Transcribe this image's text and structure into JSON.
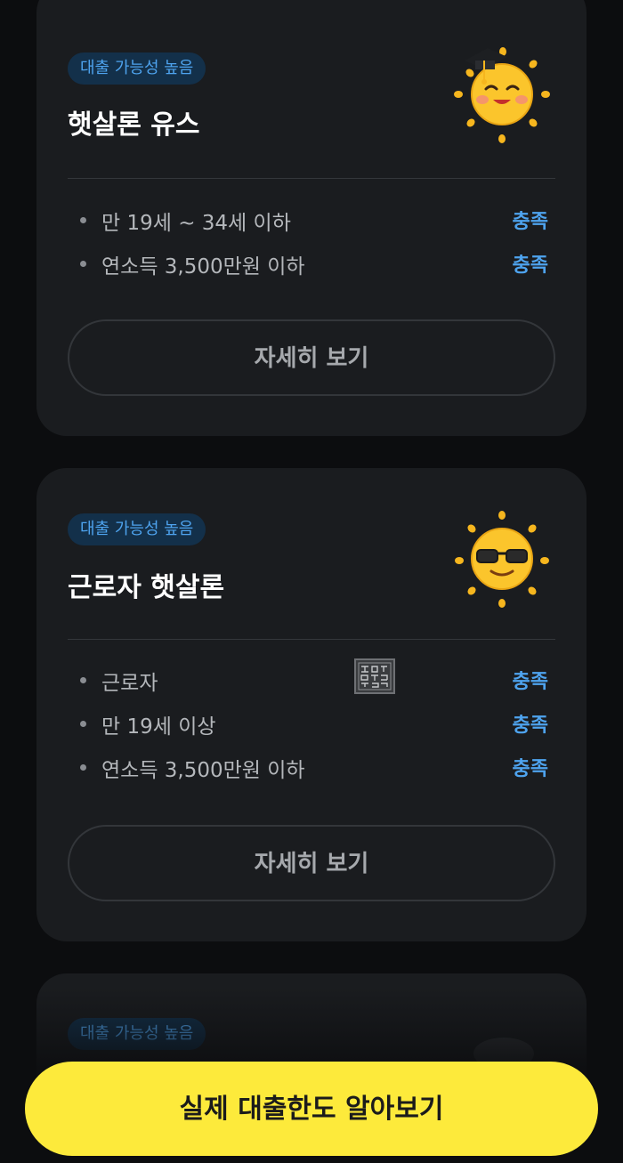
{
  "cards": [
    {
      "badge": "대출 가능성 높음",
      "title": "햇살론 유스",
      "mascot_icon": "graduation-sun-icon",
      "criteria": [
        {
          "label": "만 19세 ~ 34세 이하",
          "status": "충족"
        },
        {
          "label": "연소득 3,500만원 이하",
          "status": "충족"
        }
      ],
      "detail_button": "자세히 보기"
    },
    {
      "badge": "대출 가능성 높음",
      "title": "근로자 햇살론",
      "mascot_icon": "sunglasses-sun-icon",
      "criteria": [
        {
          "label": "근로자",
          "status": "충족"
        },
        {
          "label": "만 19세 이상",
          "status": "충족"
        },
        {
          "label": "연소득 3,500만원 이하",
          "status": "충족"
        }
      ],
      "detail_button": "자세히 보기"
    },
    {
      "badge": "대출 가능성 높음"
    }
  ],
  "cta_button": "실제 대출한도 알아보기",
  "colors": {
    "background": "#0c0d0f",
    "card": "#1a1c1f",
    "accent_blue": "#4ea3ee",
    "cta_yellow": "#fdea3b"
  }
}
